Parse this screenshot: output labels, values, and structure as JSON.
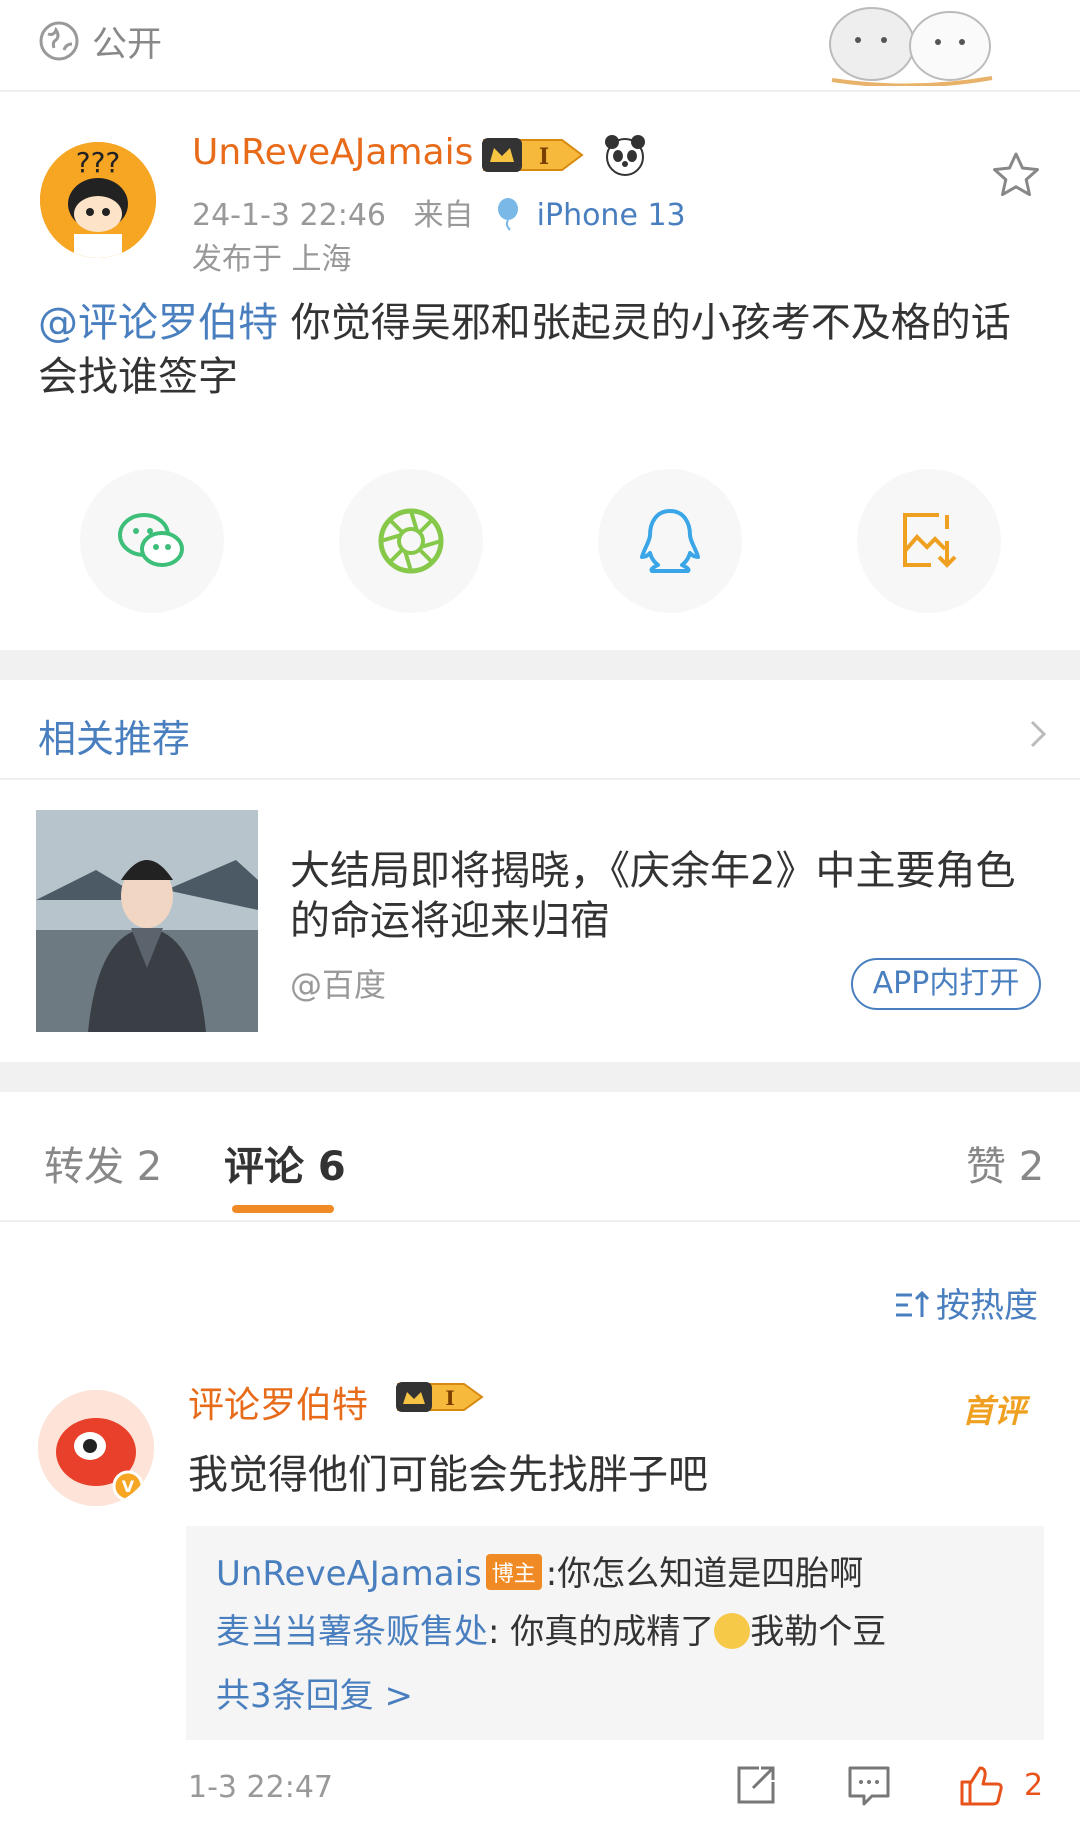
{
  "topbar": {
    "visibility": "公开",
    "icon": "globe-icon"
  },
  "post": {
    "username": "UnReveAJamais",
    "time": "24-1-3 22:46",
    "from": "来自",
    "device": "iPhone 13",
    "location": "发布于 上海",
    "mention": "@评论罗伯特",
    "text": " 你觉得吴邪和张起灵的小孩考不及格的话会找谁签字",
    "share_icons": [
      "wechat-icon",
      "moments-icon",
      "qq-icon",
      "save-image-icon"
    ]
  },
  "related": {
    "title": "相关推荐",
    "headline": "大结局即将揭晓，《庆余年2》中主要角色的命运将迎来归宿",
    "source": "@百度",
    "open_app": "APP内打开"
  },
  "tabs": {
    "repost": "转发 2",
    "comments": "评论 6",
    "likes": "赞 2"
  },
  "sort": {
    "label": "按热度"
  },
  "comment": {
    "author": "评论罗伯特",
    "first_tag": "首评",
    "text": "我觉得他们可能会先找胖子吧",
    "replies": [
      {
        "who": "UnReveAJamais",
        "tag": "博主",
        "text": ":你怎么知道是四胎啊"
      },
      {
        "who": "麦当当薯条贩售处",
        "text_before": ": 你真的成精了",
        "text_after": "我勒个豆"
      }
    ],
    "more": "共3条回复 >",
    "time": "1-3 22:47",
    "likes": "2"
  },
  "colors": {
    "accent": "#4a7fbf",
    "orange": "#e86b1a",
    "tab_underline": "#f08a24"
  }
}
